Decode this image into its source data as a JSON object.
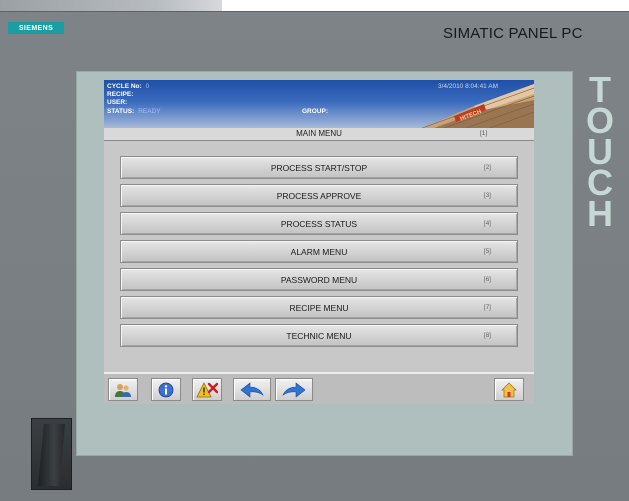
{
  "device": {
    "brand": "SIEMENS",
    "model": "SIMATIC PANEL PC",
    "bezel_label": "TOUCH"
  },
  "status": {
    "cycle_label": "CYCLE No:",
    "cycle_value": "0",
    "recipe_label": "RECIPE:",
    "user_label": "USER:",
    "status_label": "STATUS:",
    "status_value": "READY",
    "group_label": "GROUP:",
    "datetime": "3/4/2010 8:04:41 AM",
    "building_sign": "HITECH"
  },
  "main_menu": {
    "title": "MAIN MENU",
    "key": "[1]",
    "items": [
      {
        "label": "PROCESS START/STOP",
        "key": "[2]"
      },
      {
        "label": "PROCESS APPROVE",
        "key": "[3]"
      },
      {
        "label": "PROCESS STATUS",
        "key": "[4]"
      },
      {
        "label": "ALARM MENU",
        "key": "[5]"
      },
      {
        "label": "PASSWORD MENU",
        "key": "[6]"
      },
      {
        "label": "RECIPE MENU",
        "key": "[7]"
      },
      {
        "label": "TECHNIC MENU",
        "key": "[8]"
      }
    ]
  },
  "toolbar": {
    "icons": [
      "users-icon",
      "info-icon",
      "alarm-clear-icon",
      "back-arrow-icon",
      "forward-arrow-icon",
      "home-icon"
    ]
  },
  "colors": {
    "siemens_teal": "#1b9ea3",
    "header_blue": "#1f4fa6",
    "bezel": "#aebfbd",
    "housing": "#7a8084"
  }
}
